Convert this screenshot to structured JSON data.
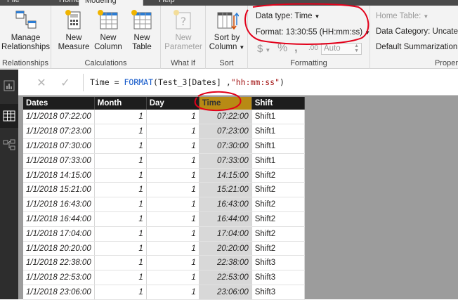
{
  "tabs": [
    "File",
    "Home",
    "Modeling",
    "Help"
  ],
  "ribbon": {
    "relationships": {
      "label_line1": "Manage",
      "label_line2": "Relationships",
      "group": "Relationships"
    },
    "calculations": {
      "new_measure": [
        "New",
        "Measure"
      ],
      "new_column": [
        "New",
        "Column"
      ],
      "new_table": [
        "New",
        "Table"
      ],
      "group": "Calculations"
    },
    "whatif": {
      "new_parameter": [
        "New",
        "Parameter"
      ],
      "group": "What If"
    },
    "sort": {
      "sort_by_column": [
        "Sort by",
        "Column"
      ],
      "group": "Sort"
    },
    "formatting": {
      "data_type": "Data type: Time",
      "format": "Format: 13:30:55 (HH:mm:ss)",
      "currency_symbol": "$",
      "percent_symbol": "%",
      "comma_symbol": ",",
      "decimal_symbol": ".00",
      "auto_label": "Auto",
      "group": "Formatting"
    },
    "properties": {
      "home_table": "Home Table:",
      "data_category": "Data Category: Uncateg",
      "default_summarization": "Default Summarization",
      "group": "Proper"
    }
  },
  "formula": {
    "prefix": "Time = ",
    "function": "FORMAT",
    "args": "(Test_3[Dates] ,",
    "string": "\"hh:mm:ss\"",
    "suffix": ")"
  },
  "table": {
    "columns": [
      "Dates",
      "Month",
      "Day",
      "Time",
      "Shift"
    ],
    "rows": [
      [
        "1/1/2018 07:22:00",
        "1",
        "1",
        "07:22:00",
        "Shift1"
      ],
      [
        "1/1/2018 07:23:00",
        "1",
        "1",
        "07:23:00",
        "Shift1"
      ],
      [
        "1/1/2018 07:30:00",
        "1",
        "1",
        "07:30:00",
        "Shift1"
      ],
      [
        "1/1/2018 07:33:00",
        "1",
        "1",
        "07:33:00",
        "Shift1"
      ],
      [
        "1/1/2018 14:15:00",
        "1",
        "1",
        "14:15:00",
        "Shift2"
      ],
      [
        "1/1/2018 15:21:00",
        "1",
        "1",
        "15:21:00",
        "Shift2"
      ],
      [
        "1/1/2018 16:43:00",
        "1",
        "1",
        "16:43:00",
        "Shift2"
      ],
      [
        "1/1/2018 16:44:00",
        "1",
        "1",
        "16:44:00",
        "Shift2"
      ],
      [
        "1/1/2018 17:04:00",
        "1",
        "1",
        "17:04:00",
        "Shift2"
      ],
      [
        "1/1/2018 20:20:00",
        "1",
        "1",
        "20:20:00",
        "Shift2"
      ],
      [
        "1/1/2018 22:38:00",
        "1",
        "1",
        "22:38:00",
        "Shift3"
      ],
      [
        "1/1/2018 22:53:00",
        "1",
        "1",
        "22:53:00",
        "Shift3"
      ],
      [
        "1/1/2018 23:06:00",
        "1",
        "1",
        "23:06:00",
        "Shift3"
      ]
    ]
  },
  "colors": {
    "accent": "#b88a14",
    "annotation": "#e2001a",
    "header": "#1d1d1d"
  }
}
